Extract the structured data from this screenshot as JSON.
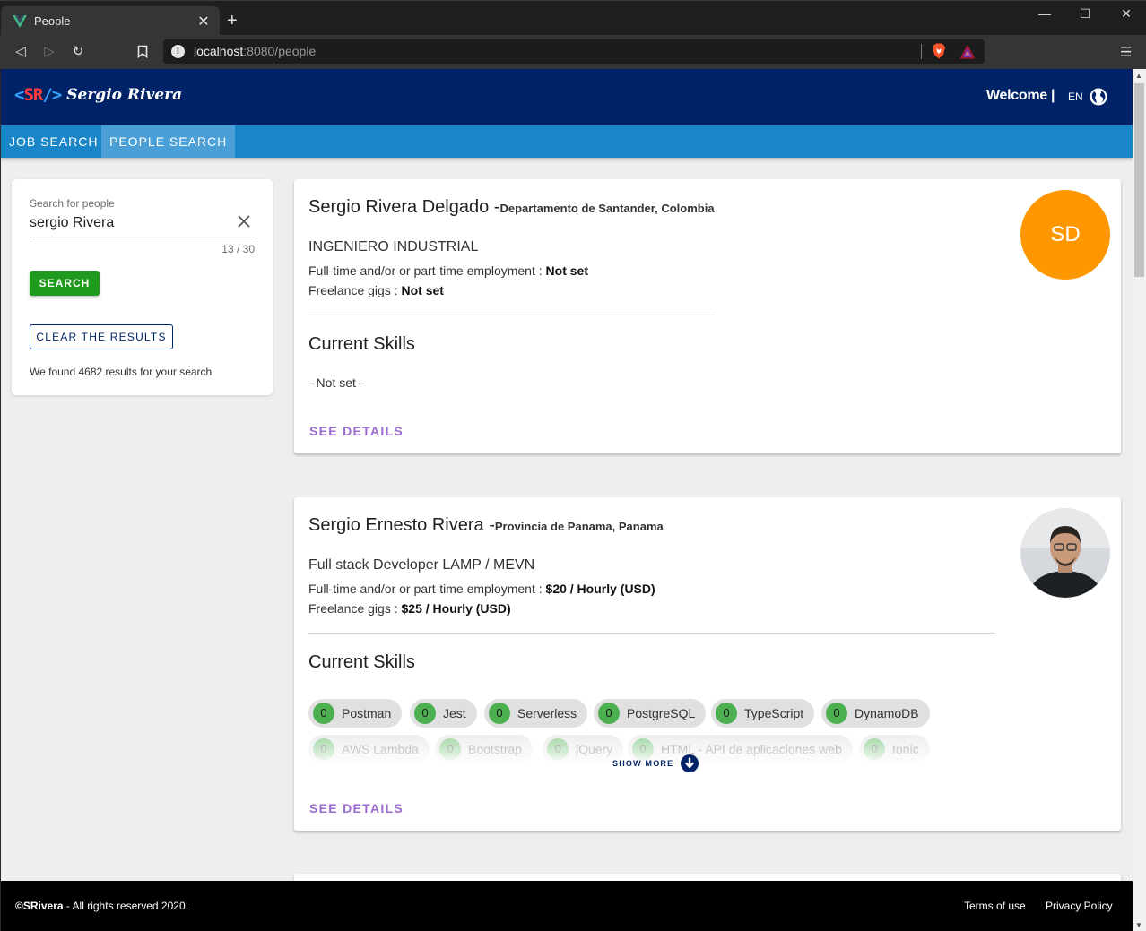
{
  "browser": {
    "tab_title": "People",
    "tab_icon": "vue-logo-icon",
    "url_host": "localhost",
    "url_path": ":8080/people"
  },
  "header": {
    "logo_mark_open": "<",
    "logo_mark_text": "SR",
    "logo_mark_close": "/>",
    "logo_name": "Sergio Rivera",
    "welcome": "Welcome |",
    "language": "EN",
    "colors": {
      "background": "#002367",
      "nav": "#1a86c8"
    }
  },
  "nav": {
    "tabs": [
      {
        "label": "JOB SEARCH",
        "active": false
      },
      {
        "label": "PEOPLE SEARCH",
        "active": true
      }
    ]
  },
  "search": {
    "label": "Search for people",
    "value": "sergio Rivera",
    "counter": "13 / 30",
    "search_button": "SEARCH",
    "clear_button": "CLEAR THE RESULTS",
    "results_text": "We found 4682 results for your search"
  },
  "people": [
    {
      "name": "Sergio Rivera Delgado",
      "separator": " -",
      "location": "Departamento de Santander, Colombia",
      "title": "INGENIERO INDUSTRIAL",
      "employment_label": "Full-time and/or or part-time employment : ",
      "employment_value": "Not set",
      "freelance_label": "Freelance gigs : ",
      "freelance_value": "Not set",
      "skills_heading": "Current Skills",
      "skills_empty": "- Not set -",
      "details_label": "SEE DETAILS",
      "avatar_initials": "SD",
      "avatar_color": "#ff9800"
    },
    {
      "name": "Sergio Ernesto Rivera",
      "separator": " -",
      "location": "Provincia de Panama, Panama",
      "title": "Full stack Developer LAMP / MEVN",
      "employment_label": "Full-time and/or or part-time employment : ",
      "employment_value": "$20 / Hourly (USD)",
      "freelance_label": "Freelance gigs : ",
      "freelance_value": "$25 / Hourly (USD)",
      "skills_heading": "Current Skills",
      "skills": [
        {
          "count": "0",
          "label": "Postman"
        },
        {
          "count": "0",
          "label": "Jest"
        },
        {
          "count": "0",
          "label": "Serverless"
        },
        {
          "count": "0",
          "label": "PostgreSQL"
        },
        {
          "count": "0",
          "label": "TypeScript"
        },
        {
          "count": "0",
          "label": "DynamoDB"
        },
        {
          "count": "0",
          "label": "AWS Lambda"
        },
        {
          "count": "0",
          "label": "Bootstrap"
        },
        {
          "count": "0",
          "label": "jQuery"
        },
        {
          "count": "0",
          "label": "HTML - API de aplicaciones web"
        },
        {
          "count": "0",
          "label": "Ionic"
        }
      ],
      "show_more": "SHOW MORE",
      "details_label": "SEE DETAILS",
      "avatar": "profile-photo"
    }
  ],
  "footer": {
    "copyright_brand": "©SRivera",
    "copyright_text": " - All rights reserved 2020.",
    "terms": "Terms of use",
    "privacy": "Privacy Policy"
  }
}
